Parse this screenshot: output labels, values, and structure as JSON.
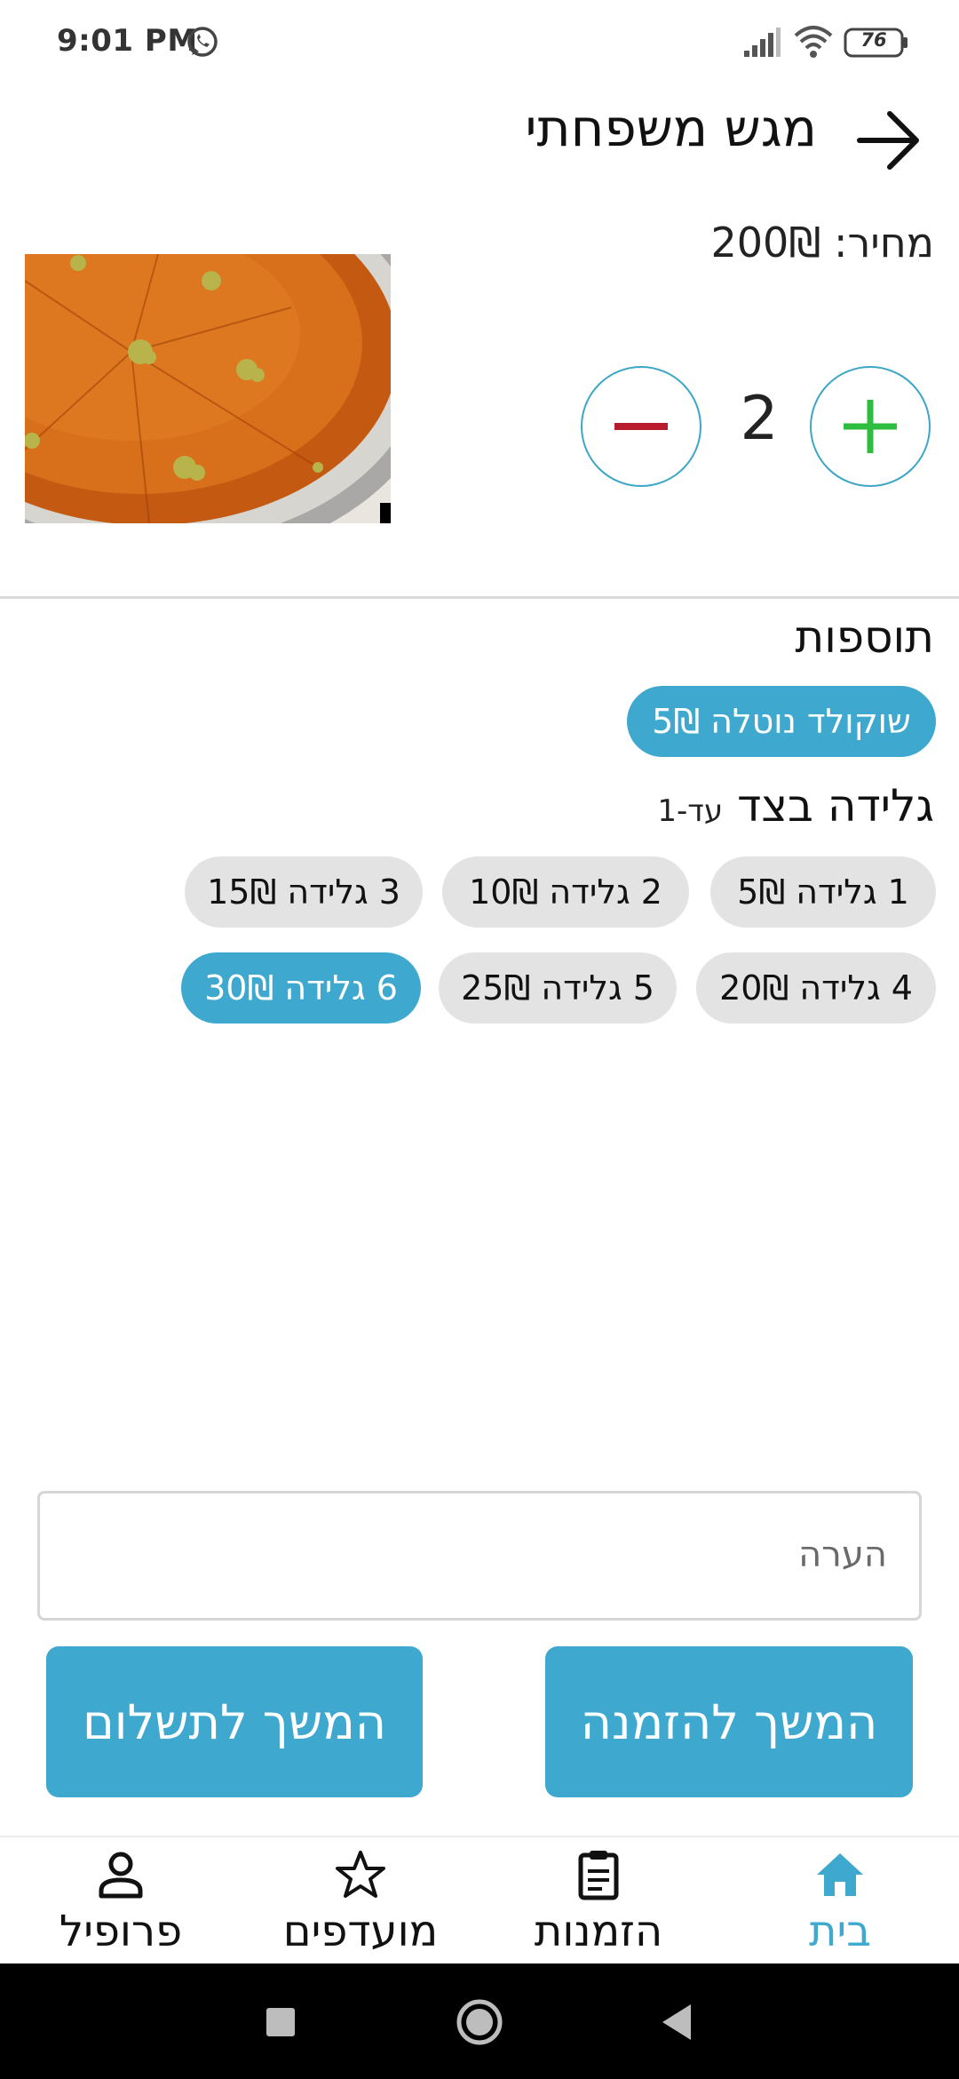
{
  "status_bar": {
    "time": "9:01 PM",
    "battery": "76"
  },
  "header": {
    "title": "מגש משפחתי"
  },
  "product": {
    "price": "מחיר: 200₪",
    "quantity": "2"
  },
  "extras": {
    "title": "תוספות",
    "chips": [
      {
        "label": "שוקולד נוטלה 5₪",
        "selected": true
      }
    ]
  },
  "ice_cream": {
    "title": "גלידה בצד",
    "subtitle": "עד-1",
    "chips": [
      {
        "label": "1 גלידה  5₪",
        "selected": false
      },
      {
        "label": "2 גלידה  10₪",
        "selected": false
      },
      {
        "label": "3 גלידה 15₪",
        "selected": false
      },
      {
        "label": "4 גלידה 20₪",
        "selected": false
      },
      {
        "label": "5 גלידה 25₪",
        "selected": false
      },
      {
        "label": "6 גלידה 30₪",
        "selected": true
      }
    ]
  },
  "note": {
    "placeholder": "הערה"
  },
  "buttons": {
    "continue_order": "המשך להזמנה",
    "continue_payment": "המשך לתשלום"
  },
  "nav": {
    "home": "בית",
    "orders": "הזמנות",
    "favorites": "מועדפים",
    "profile": "פרופיל"
  },
  "colors": {
    "accent": "#3ea8cf",
    "plus": "#2ebd3e",
    "minus": "#b81b2e",
    "chip_unselected": "#e3e3e3"
  },
  "icons": [
    "whatsapp-icon",
    "signal-icon",
    "wifi-icon",
    "battery-icon",
    "back-arrow-icon",
    "plus-icon",
    "minus-icon",
    "home-icon",
    "clipboard-icon",
    "star-icon",
    "person-icon",
    "square-icon",
    "circle-icon",
    "triangle-back-icon"
  ]
}
